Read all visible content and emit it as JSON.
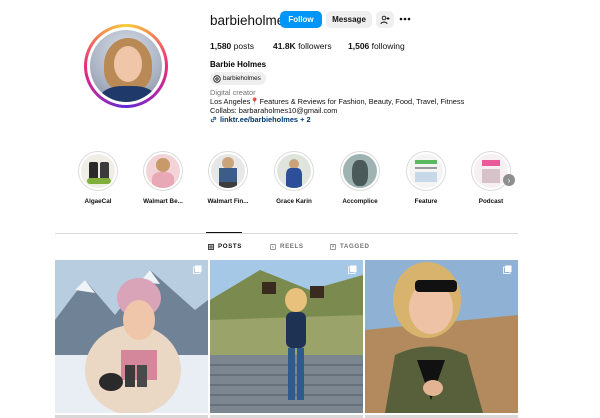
{
  "profile": {
    "username": "barbieholmes",
    "follow_label": "Follow",
    "message_label": "Message",
    "posts_count": "1,580",
    "posts_label": "posts",
    "followers_count": "41.8K",
    "followers_label": "followers",
    "following_count": "1,506",
    "following_label": "following",
    "full_name": "Barbie Holmes",
    "threads_handle": "barbieholmes",
    "category": "Digital creator",
    "bio_line1": "Los Angeles📍Features & Reviews for Fashion, Beauty, Food, Travel, Fitness",
    "bio_line2": "Collabs: barbaraholmes10@gmail.com",
    "link": "linktr.ee/barbieholmes + 2"
  },
  "highlights": [
    {
      "label": "AlgaeCal"
    },
    {
      "label": "Walmart Be..."
    },
    {
      "label": "Walmart Fin..."
    },
    {
      "label": "Grace Karin"
    },
    {
      "label": "Accomplice"
    },
    {
      "label": "Feature"
    },
    {
      "label": "Podcast"
    }
  ],
  "tabs": {
    "posts": "POSTS",
    "reels": "REELS",
    "tagged": "TAGGED",
    "active": "posts"
  },
  "colors": {
    "follow_blue": "#0095f6",
    "link_blue": "#00376b",
    "muted_gray": "#737373"
  },
  "icons": [
    "add-user-icon",
    "more-options-icon",
    "threads-icon",
    "link-icon",
    "grid-icon",
    "reels-icon",
    "tagged-icon",
    "chevron-right-icon",
    "multi-photo-icon"
  ]
}
